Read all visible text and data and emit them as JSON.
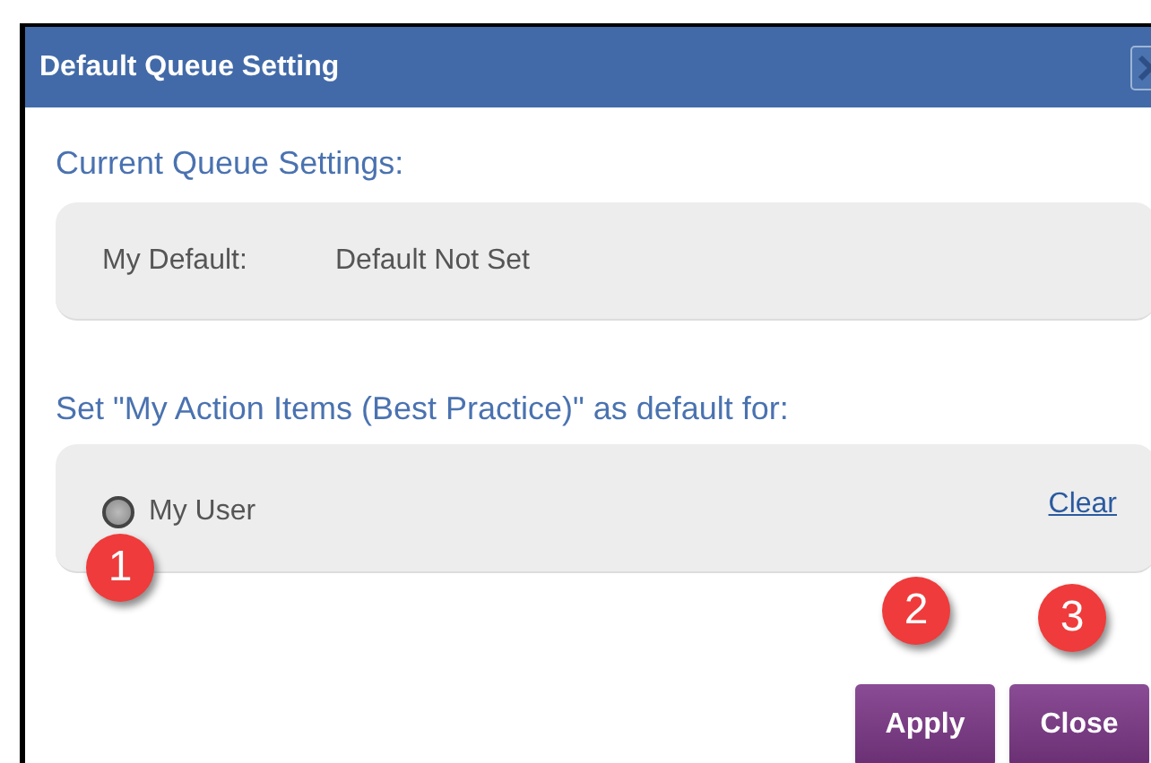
{
  "dialog": {
    "title": "Default Queue Setting"
  },
  "current": {
    "heading": "Current Queue Settings:",
    "label": "My Default:",
    "value": "Default Not Set"
  },
  "set_default": {
    "heading": "Set \"My Action Items (Best Practice)\" as default for:",
    "options": [
      {
        "label": "My User",
        "selected": false
      }
    ],
    "clear_link": "Clear"
  },
  "buttons": [
    "Apply",
    "Close"
  ],
  "markers": [
    "1",
    "2",
    "3"
  ]
}
